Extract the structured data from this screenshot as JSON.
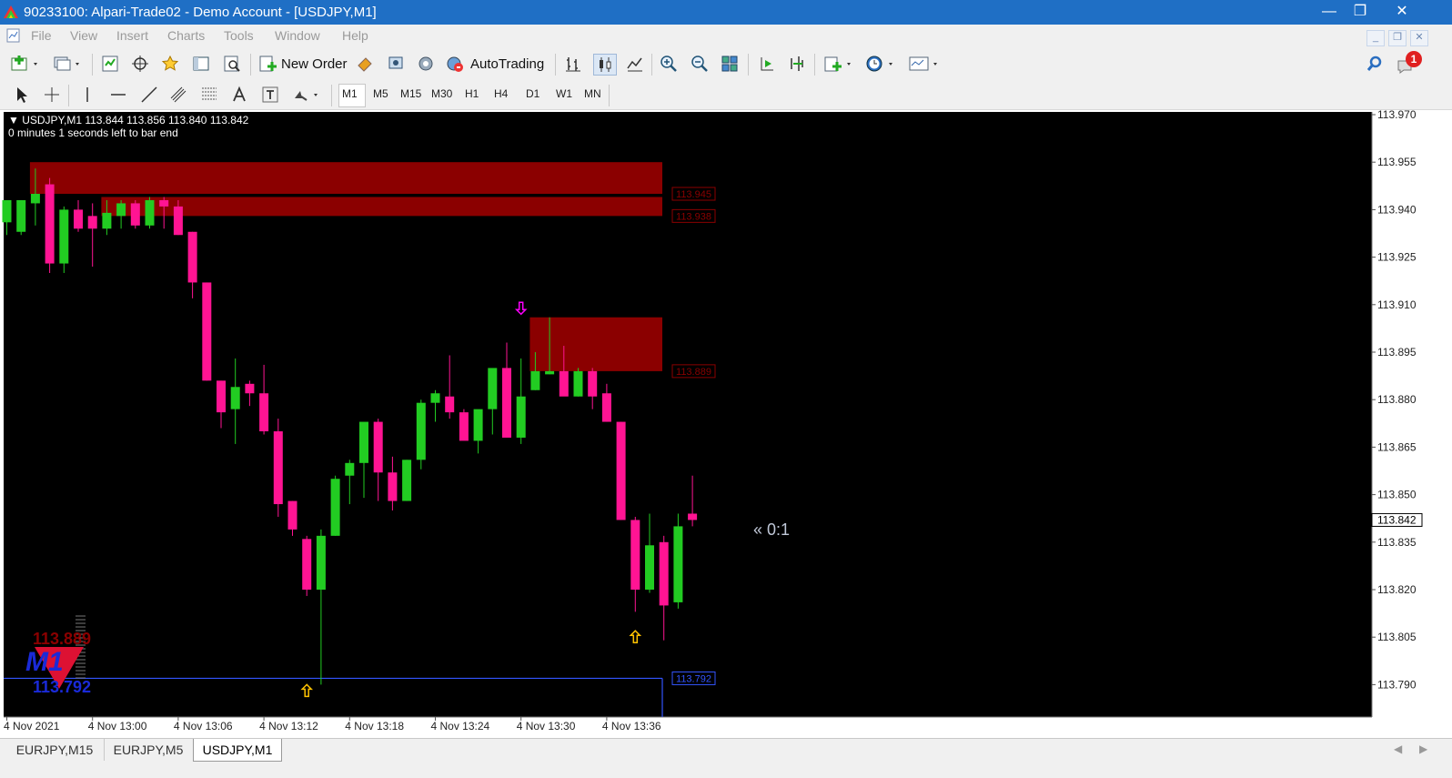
{
  "window": {
    "title": "90233100: Alpari-Trade02 - Demo Account - [USDJPY,M1]",
    "titlebar_color": "#1f6fc5"
  },
  "menu": {
    "items": [
      "File",
      "View",
      "Insert",
      "Charts",
      "Tools",
      "Window",
      "Help"
    ]
  },
  "toolbar": {
    "new_order_label": "New Order",
    "autotrading_label": "AutoTrading",
    "notification_count": "1"
  },
  "timeframes": [
    "M1",
    "M5",
    "M15",
    "M30",
    "H1",
    "H4",
    "D1",
    "W1",
    "MN"
  ],
  "active_timeframe": "M1",
  "chart": {
    "info_line": "USDJPY,M1  113.844 113.856 113.840 113.842",
    "timer_line": "0 minutes 1 seconds left to bar end",
    "countdown_label": "« 0:1",
    "current_price": "113.842",
    "indicator": {
      "upper_price": "113.889",
      "timeframe": "M1",
      "lower_price": "113.792"
    },
    "zone_labels": [
      "113.945",
      "113.938",
      "113.889"
    ],
    "support_label": "113.792",
    "colors": {
      "bull": "#22cc22",
      "bear": "#ff1493",
      "zone": "#8b0000",
      "support_line": "#3355ff",
      "up_arrow": "#ffc200",
      "down_arrow": "#ff00ff"
    }
  },
  "chart_data": {
    "type": "candlestick",
    "symbol": "USDJPY",
    "timeframe": "M1",
    "y_ticks": [
      "113.970",
      "113.955",
      "113.940",
      "113.925",
      "113.910",
      "113.895",
      "113.880",
      "113.865",
      "113.850",
      "113.835",
      "113.820",
      "113.805",
      "113.790"
    ],
    "x_ticks": [
      "4 Nov 2021",
      "4 Nov 13:00",
      "4 Nov 13:06",
      "4 Nov 13:12",
      "4 Nov 13:18",
      "4 Nov 13:24",
      "4 Nov 13:30",
      "4 Nov 13:36"
    ],
    "ylim": [
      113.7875,
      113.97
    ],
    "candles": [
      {
        "o": 113.936,
        "h": 113.943,
        "l": 113.932,
        "c": 113.943
      },
      {
        "o": 113.933,
        "h": 113.943,
        "l": 113.932,
        "c": 113.943
      },
      {
        "o": 113.942,
        "h": 113.953,
        "l": 113.935,
        "c": 113.945
      },
      {
        "o": 113.948,
        "h": 113.95,
        "l": 113.92,
        "c": 113.923
      },
      {
        "o": 113.923,
        "h": 113.941,
        "l": 113.92,
        "c": 113.94
      },
      {
        "o": 113.94,
        "h": 113.943,
        "l": 113.933,
        "c": 113.934
      },
      {
        "o": 113.938,
        "h": 113.942,
        "l": 113.922,
        "c": 113.934
      },
      {
        "o": 113.934,
        "h": 113.943,
        "l": 113.932,
        "c": 113.939
      },
      {
        "o": 113.938,
        "h": 113.943,
        "l": 113.934,
        "c": 113.942
      },
      {
        "o": 113.942,
        "h": 113.943,
        "l": 113.934,
        "c": 113.935
      },
      {
        "o": 113.935,
        "h": 113.944,
        "l": 113.934,
        "c": 113.943
      },
      {
        "o": 113.943,
        "h": 113.944,
        "l": 113.934,
        "c": 113.941
      },
      {
        "o": 113.941,
        "h": 113.943,
        "l": 113.932,
        "c": 113.932
      },
      {
        "o": 113.933,
        "h": 113.933,
        "l": 113.912,
        "c": 113.917
      },
      {
        "o": 113.917,
        "h": 113.917,
        "l": 113.886,
        "c": 113.886
      },
      {
        "o": 113.886,
        "h": 113.886,
        "l": 113.871,
        "c": 113.876
      },
      {
        "o": 113.877,
        "h": 113.893,
        "l": 113.866,
        "c": 113.884
      },
      {
        "o": 113.885,
        "h": 113.886,
        "l": 113.878,
        "c": 113.882
      },
      {
        "o": 113.882,
        "h": 113.891,
        "l": 113.869,
        "c": 113.87
      },
      {
        "o": 113.87,
        "h": 113.874,
        "l": 113.843,
        "c": 113.847
      },
      {
        "o": 113.848,
        "h": 113.848,
        "l": 113.837,
        "c": 113.839
      },
      {
        "o": 113.836,
        "h": 113.837,
        "l": 113.818,
        "c": 113.82
      },
      {
        "o": 113.82,
        "h": 113.839,
        "l": 113.79,
        "c": 113.837
      },
      {
        "o": 113.837,
        "h": 113.856,
        "l": 113.837,
        "c": 113.855
      },
      {
        "o": 113.856,
        "h": 113.861,
        "l": 113.847,
        "c": 113.86
      },
      {
        "o": 113.86,
        "h": 113.872,
        "l": 113.849,
        "c": 113.873
      },
      {
        "o": 113.873,
        "h": 113.874,
        "l": 113.848,
        "c": 113.857
      },
      {
        "o": 113.857,
        "h": 113.862,
        "l": 113.845,
        "c": 113.848
      },
      {
        "o": 113.848,
        "h": 113.861,
        "l": 113.848,
        "c": 113.861
      },
      {
        "o": 113.861,
        "h": 113.88,
        "l": 113.858,
        "c": 113.879
      },
      {
        "o": 113.879,
        "h": 113.883,
        "l": 113.873,
        "c": 113.882
      },
      {
        "o": 113.881,
        "h": 113.894,
        "l": 113.874,
        "c": 113.876
      },
      {
        "o": 113.876,
        "h": 113.877,
        "l": 113.868,
        "c": 113.867
      },
      {
        "o": 113.867,
        "h": 113.871,
        "l": 113.863,
        "c": 113.877
      },
      {
        "o": 113.877,
        "h": 113.885,
        "l": 113.869,
        "c": 113.89
      },
      {
        "o": 113.89,
        "h": 113.898,
        "l": 113.869,
        "c": 113.868
      },
      {
        "o": 113.868,
        "h": 113.893,
        "l": 113.866,
        "c": 113.881
      },
      {
        "o": 113.883,
        "h": 113.895,
        "l": 113.883,
        "c": 113.889
      },
      {
        "o": 113.888,
        "h": 113.906,
        "l": 113.888,
        "c": 113.889
      },
      {
        "o": 113.889,
        "h": 113.897,
        "l": 113.882,
        "c": 113.881
      },
      {
        "o": 113.881,
        "h": 113.89,
        "l": 113.881,
        "c": 113.889
      },
      {
        "o": 113.889,
        "h": 113.89,
        "l": 113.877,
        "c": 113.881
      },
      {
        "o": 113.882,
        "h": 113.885,
        "l": 113.873,
        "c": 113.873
      },
      {
        "o": 113.873,
        "h": 113.873,
        "l": 113.842,
        "c": 113.842
      },
      {
        "o": 113.842,
        "h": 113.843,
        "l": 113.813,
        "c": 113.82
      },
      {
        "o": 113.82,
        "h": 113.844,
        "l": 113.819,
        "c": 113.834
      },
      {
        "o": 113.835,
        "h": 113.837,
        "l": 113.804,
        "c": 113.815
      },
      {
        "o": 113.816,
        "h": 113.844,
        "l": 113.814,
        "c": 113.84
      },
      {
        "o": 113.844,
        "h": 113.856,
        "l": 113.84,
        "c": 113.842
      }
    ],
    "zones": [
      {
        "top": 113.955,
        "bottom": 113.945,
        "label": "113.945",
        "start_index": 2
      },
      {
        "top": 113.944,
        "bottom": 113.938,
        "label": "113.938",
        "start_index": 7
      },
      {
        "top": 113.906,
        "bottom": 113.889,
        "label": "113.889",
        "start_index": 37
      }
    ],
    "support_level": {
      "value": 113.792,
      "label": "113.792"
    },
    "arrows": [
      {
        "type": "up",
        "index": 21,
        "price": 113.788
      },
      {
        "type": "down",
        "index": 36,
        "price": 113.909
      },
      {
        "type": "up",
        "index": 44,
        "price": 113.805
      }
    ]
  },
  "tabs": [
    "EURJPY,M15",
    "EURJPY,M5",
    "USDJPY,M1"
  ],
  "active_tab": "USDJPY,M1"
}
